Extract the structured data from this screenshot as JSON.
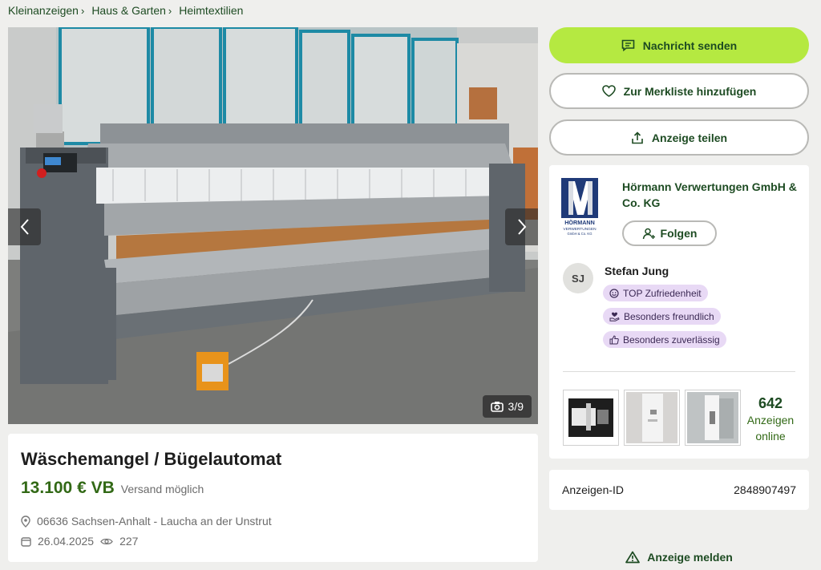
{
  "breadcrumb": {
    "items": [
      {
        "label": "Kleinanzeigen"
      },
      {
        "label": "Haus & Garten"
      },
      {
        "label": "Heimtextilien"
      }
    ],
    "separator": "›"
  },
  "gallery": {
    "counter": "3/9",
    "icons": {
      "prev": "chevron-left-icon",
      "next": "chevron-right-icon",
      "counter": "camera-icon"
    }
  },
  "ad": {
    "title": "Wäschemangel / Bügelautomat",
    "price": "13.100 € VB",
    "shipping": "Versand möglich",
    "location": "06636 Sachsen-Anhalt - Laucha an der Unstrut",
    "date": "26.04.2025",
    "views": "227"
  },
  "actions": {
    "message": "Nachricht senden",
    "watchlist": "Zur Merkliste hinzufügen",
    "share": "Anzeige teilen",
    "report": "Anzeige melden"
  },
  "seller": {
    "company": "Hörmann Verwertungen GmbH & Co. KG",
    "logo_text": "HÖRMANN",
    "logo_sub": "VERWERTUNGEN",
    "logo_sub2": "GmbH & Co. KG",
    "follow": "Folgen",
    "contact_initials": "SJ",
    "contact_name": "Stefan Jung",
    "badges": [
      {
        "label": "TOP Zufriedenheit",
        "icon": "smiley-icon"
      },
      {
        "label": "Besonders freundlich",
        "icon": "heart-hand-icon"
      },
      {
        "label": "Besonders zuverlässig",
        "icon": "thumbs-up-icon"
      }
    ],
    "ads_count": "642",
    "ads_label": "Anzeigen online"
  },
  "details": {
    "id_label": "Anzeigen-ID",
    "id_value": "2848907497"
  },
  "colors": {
    "primary": "#b5e941",
    "brand_dark": "#1d4b22",
    "price": "#326916",
    "badge_bg": "#e8d9f5",
    "page_bg": "#efefed"
  }
}
